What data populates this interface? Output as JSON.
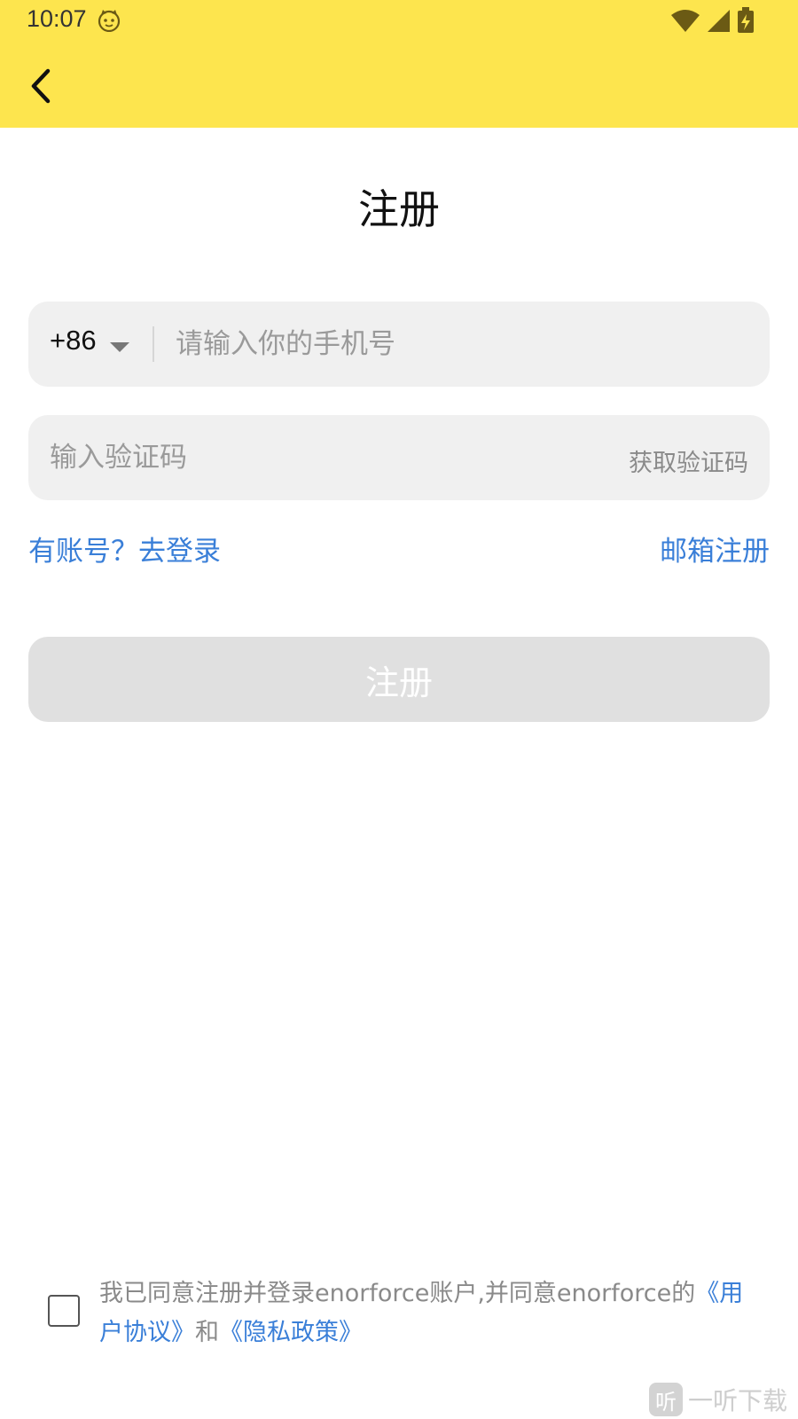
{
  "status_bar": {
    "time": "10:07"
  },
  "header": {
    "back_icon": "chevron-left-icon"
  },
  "page": {
    "title": "注册"
  },
  "phone": {
    "country_code": "+86",
    "placeholder": "请输入你的手机号"
  },
  "code": {
    "placeholder": "输入验证码",
    "get_code_label": "获取验证码"
  },
  "links": {
    "login": "有账号？去登录",
    "email_register": "邮箱注册"
  },
  "submit": {
    "label": "注册"
  },
  "agreement": {
    "text": "我已同意注册并登录enorforce账户,并同意enorforce的",
    "user_agreement": "《用户协议》",
    "and": "和",
    "privacy_policy": "《隐私政策》"
  },
  "watermark": {
    "badge": "听",
    "text": "一听下载"
  },
  "colors": {
    "header_bg": "#fde54e",
    "link": "#3a7fd8",
    "button_disabled": "#e0e0e0",
    "field_bg": "#f0f0f0"
  }
}
